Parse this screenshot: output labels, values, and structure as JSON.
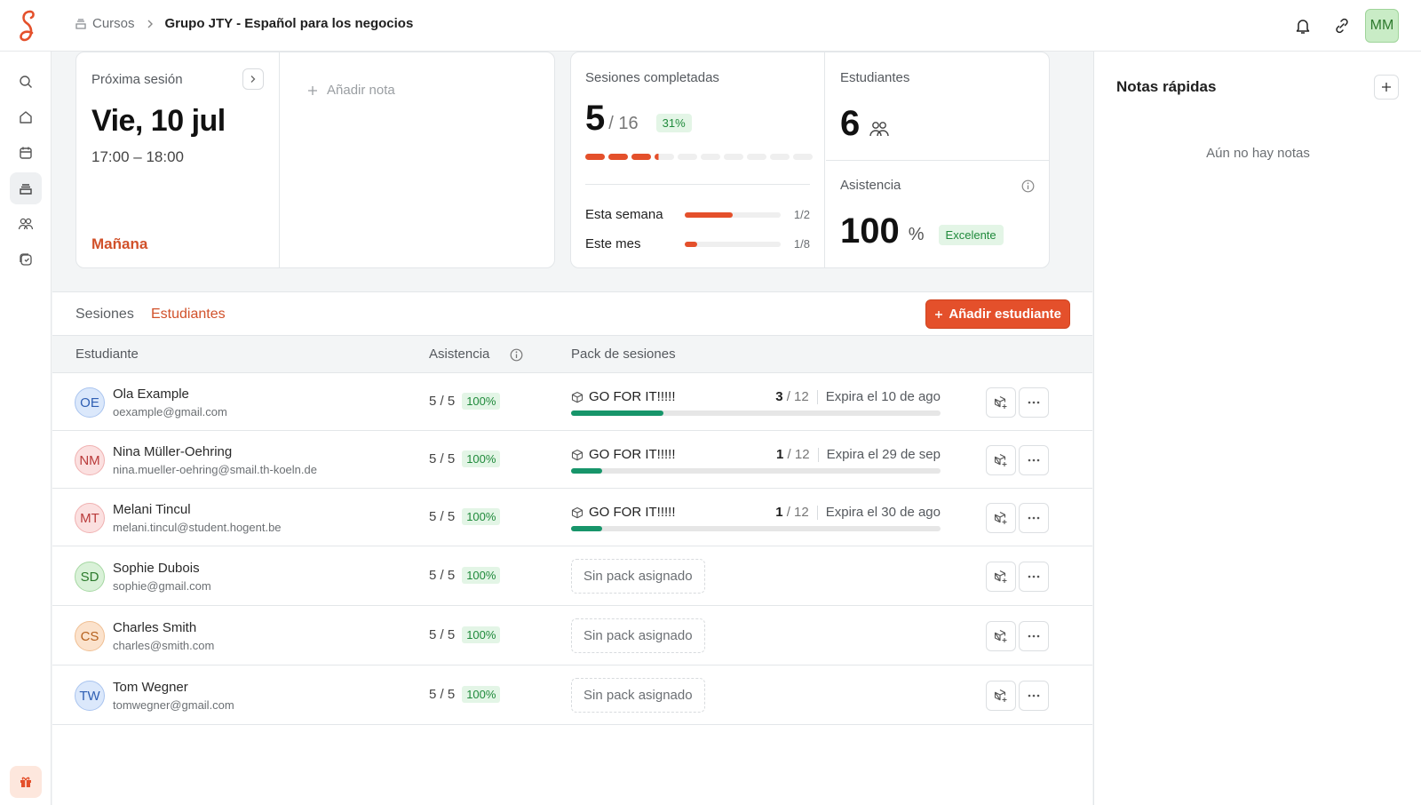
{
  "header": {
    "breadcrumb_root": "Cursos",
    "breadcrumb_current": "Grupo JTY - Español para los negocios",
    "user_initials": "MM",
    "icons": [
      "bell-icon",
      "link-icon"
    ]
  },
  "sidebar": {
    "items": [
      "search-icon",
      "home-icon",
      "calendar-icon",
      "courses-icon",
      "students-icon",
      "packages-icon"
    ],
    "active": "courses-icon",
    "bottom": "gift-icon"
  },
  "next_session": {
    "title": "Próxima sesión",
    "date": "Vie, 10 jul",
    "time": "17:00 – 18:00",
    "relative": "Mañana",
    "add_note": "Añadir nota"
  },
  "sessions_completed": {
    "title": "Sesiones completadas",
    "done": "5",
    "total": "/ 16",
    "percent": "31%",
    "segments_total": 10,
    "segments_done": 3.2,
    "week_label": "Esta semana",
    "week_value": "1/2",
    "week_fraction": 0.5,
    "month_label": "Este mes",
    "month_value": "1/8",
    "month_fraction": 0.125
  },
  "students_card": {
    "title": "Estudiantes",
    "count": "6"
  },
  "attendance_card": {
    "title": "Asistencia",
    "value": "100",
    "unit": "%",
    "badge": "Excelente"
  },
  "tabs": {
    "sessions": "Sesiones",
    "students": "Estudiantes",
    "active": "students"
  },
  "add_student_label": "Añadir estudiante",
  "table": {
    "headers": {
      "student": "Estudiante",
      "attendance": "Asistencia",
      "pack": "Pack de sesiones"
    },
    "rows": [
      {
        "initials": "OE",
        "color": "blue",
        "name": "Ola Example",
        "email": "oexample@gmail.com",
        "attendance": "5 / 5",
        "pct": "100%",
        "pack": {
          "name": "GO FOR IT!!!!!",
          "used": "3",
          "total": "/ 12",
          "expires": "Expira el 10 de ago",
          "fraction": 0.25
        }
      },
      {
        "initials": "NM",
        "color": "red",
        "name": "Nina Müller-Oehring",
        "email": "nina.mueller-oehring@smail.th-koeln.de",
        "attendance": "5 / 5",
        "pct": "100%",
        "pack": {
          "name": "GO FOR IT!!!!!",
          "used": "1",
          "total": "/ 12",
          "expires": "Expira el 29 de sep",
          "fraction": 0.083
        }
      },
      {
        "initials": "MT",
        "color": "red",
        "name": "Melani Tincul",
        "email": "melani.tincul@student.hogent.be",
        "attendance": "5 / 5",
        "pct": "100%",
        "pack": {
          "name": "GO FOR IT!!!!!",
          "used": "1",
          "total": "/ 12",
          "expires": "Expira el 30 de ago",
          "fraction": 0.083
        }
      },
      {
        "initials": "SD",
        "color": "green",
        "name": "Sophie Dubois",
        "email": "sophie@gmail.com",
        "attendance": "5 / 5",
        "pct": "100%",
        "no_pack": "Sin pack asignado"
      },
      {
        "initials": "CS",
        "color": "orange",
        "name": "Charles Smith",
        "email": "charles@smith.com",
        "attendance": "5 / 5",
        "pct": "100%",
        "no_pack": "Sin pack asignado"
      },
      {
        "initials": "TW",
        "color": "blue",
        "name": "Tom Wegner",
        "email": "tomwegner@gmail.com",
        "attendance": "5 / 5",
        "pct": "100%",
        "no_pack": "Sin pack asignado"
      }
    ]
  },
  "notes_panel": {
    "title": "Notas rápidas",
    "empty": "Aún no hay notas"
  },
  "colors": {
    "accent": "#e4502b",
    "success": "#17956a"
  }
}
